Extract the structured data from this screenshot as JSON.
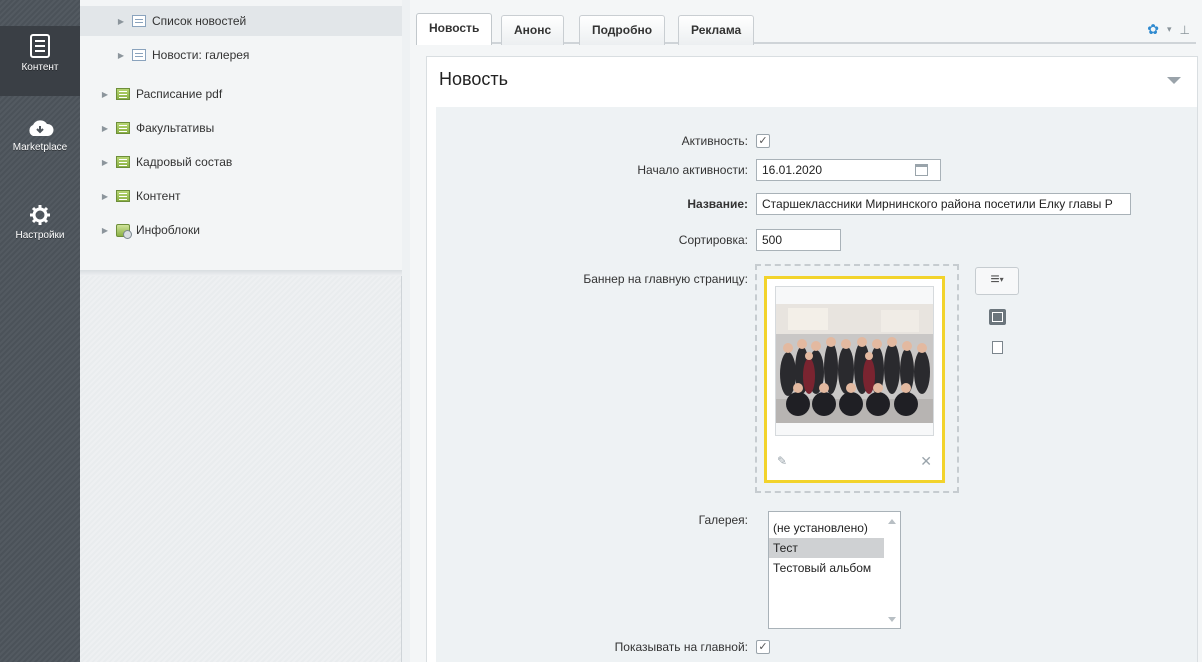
{
  "rail": {
    "items": [
      {
        "label": "Контент",
        "icon": "document-icon"
      },
      {
        "label": "Marketplace",
        "icon": "cloud-download-icon"
      },
      {
        "label": "Настройки",
        "icon": "gear-icon"
      }
    ]
  },
  "tree": {
    "items": [
      {
        "label": "Список новостей",
        "icon": "list-icon"
      },
      {
        "label": "Новости: галерея",
        "icon": "list-icon"
      },
      {
        "label": "Расписание pdf",
        "icon": "folder-icon"
      },
      {
        "label": "Факультативы",
        "icon": "folder-icon"
      },
      {
        "label": "Кадровый состав",
        "icon": "folder-icon"
      },
      {
        "label": "Контент",
        "icon": "folder-icon"
      },
      {
        "label": "Инфоблоки",
        "icon": "infoblock-icon"
      }
    ]
  },
  "tabs": [
    {
      "label": "Новость"
    },
    {
      "label": "Анонс"
    },
    {
      "label": "Подробно"
    },
    {
      "label": "Реклама"
    }
  ],
  "section": {
    "title": "Новость"
  },
  "form": {
    "active_label": "Активность:",
    "active_checked": "✓",
    "start_label": "Начало активности:",
    "start_value": "16.01.2020",
    "name_label": "Название:",
    "name_value": "Старшеклассники Мирнинского района посетили Елку главы Р",
    "sort_label": "Сортировка:",
    "sort_value": "500",
    "banner_label": "Баннер на главную страницу:",
    "gallery_label": "Галерея:",
    "gallery_options": [
      "(не установлено)",
      "Тест",
      "Тестовый альбом"
    ],
    "gallery_selected": "Тест",
    "show_main_label": "Показывать на главной:",
    "show_main_checked": "✓"
  },
  "colors": {
    "rail_bg": "#4b5259",
    "banner_highlight": "#f2d32b",
    "gear_accent": "#2f8ad0"
  }
}
